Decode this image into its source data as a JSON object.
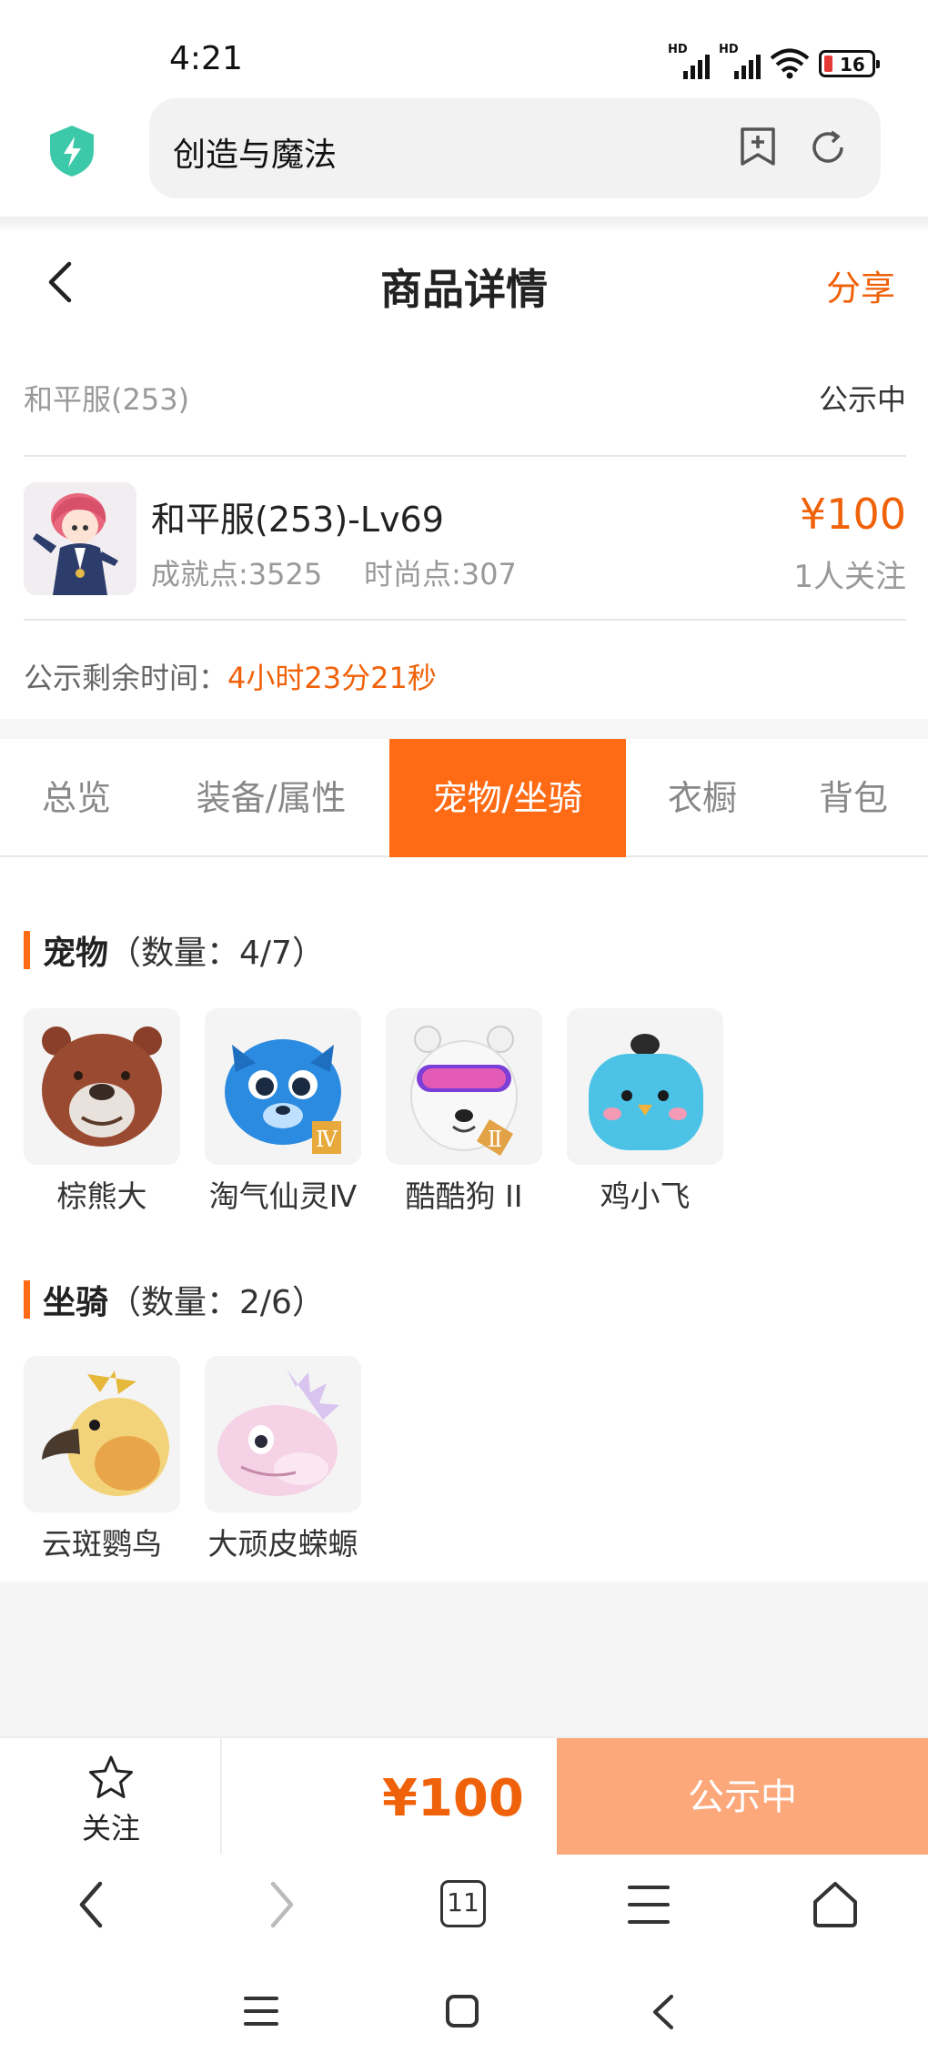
{
  "status_bar": {
    "time": "4:21",
    "battery": "16",
    "hd1": "HD",
    "hd2": "HD"
  },
  "browser": {
    "url_text": "创造与魔法"
  },
  "header": {
    "title": "商品详情",
    "share_label": "分享"
  },
  "listing": {
    "server": "和平服(253)",
    "status": "公示中",
    "name": "和平服(253)-Lv69",
    "achievement": "成就点:3525",
    "fashion": "时尚点:307",
    "price": "¥100",
    "followers": "1人关注",
    "remaining_label": "公示剩余时间：",
    "remaining_time": "4小时23分21秒"
  },
  "tabs": [
    {
      "label": "总览"
    },
    {
      "label": "装备/属性"
    },
    {
      "label": "宠物/坐骑"
    },
    {
      "label": "衣橱"
    },
    {
      "label": "背包"
    }
  ],
  "active_tab": "宠物/坐骑",
  "pets": {
    "title": "宠物",
    "count": "（数量：4/7）",
    "items": [
      {
        "name": "棕熊大"
      },
      {
        "name": "淘气仙灵Ⅳ"
      },
      {
        "name": "酷酷狗 II"
      },
      {
        "name": "鸡小飞"
      }
    ]
  },
  "mounts": {
    "title": "坐骑",
    "count": "（数量：2/6）",
    "items": [
      {
        "name": "云斑鹦鸟"
      },
      {
        "name": "大顽皮蝾螈"
      }
    ]
  },
  "bottom_bar": {
    "follow_label": "关注",
    "price": "¥100",
    "action_label": "公示中"
  },
  "browser_nav": {
    "tab_count": "11"
  },
  "colors": {
    "accent": "#ff6a14",
    "price": "#f0620a",
    "action_button": "#fca87a"
  }
}
